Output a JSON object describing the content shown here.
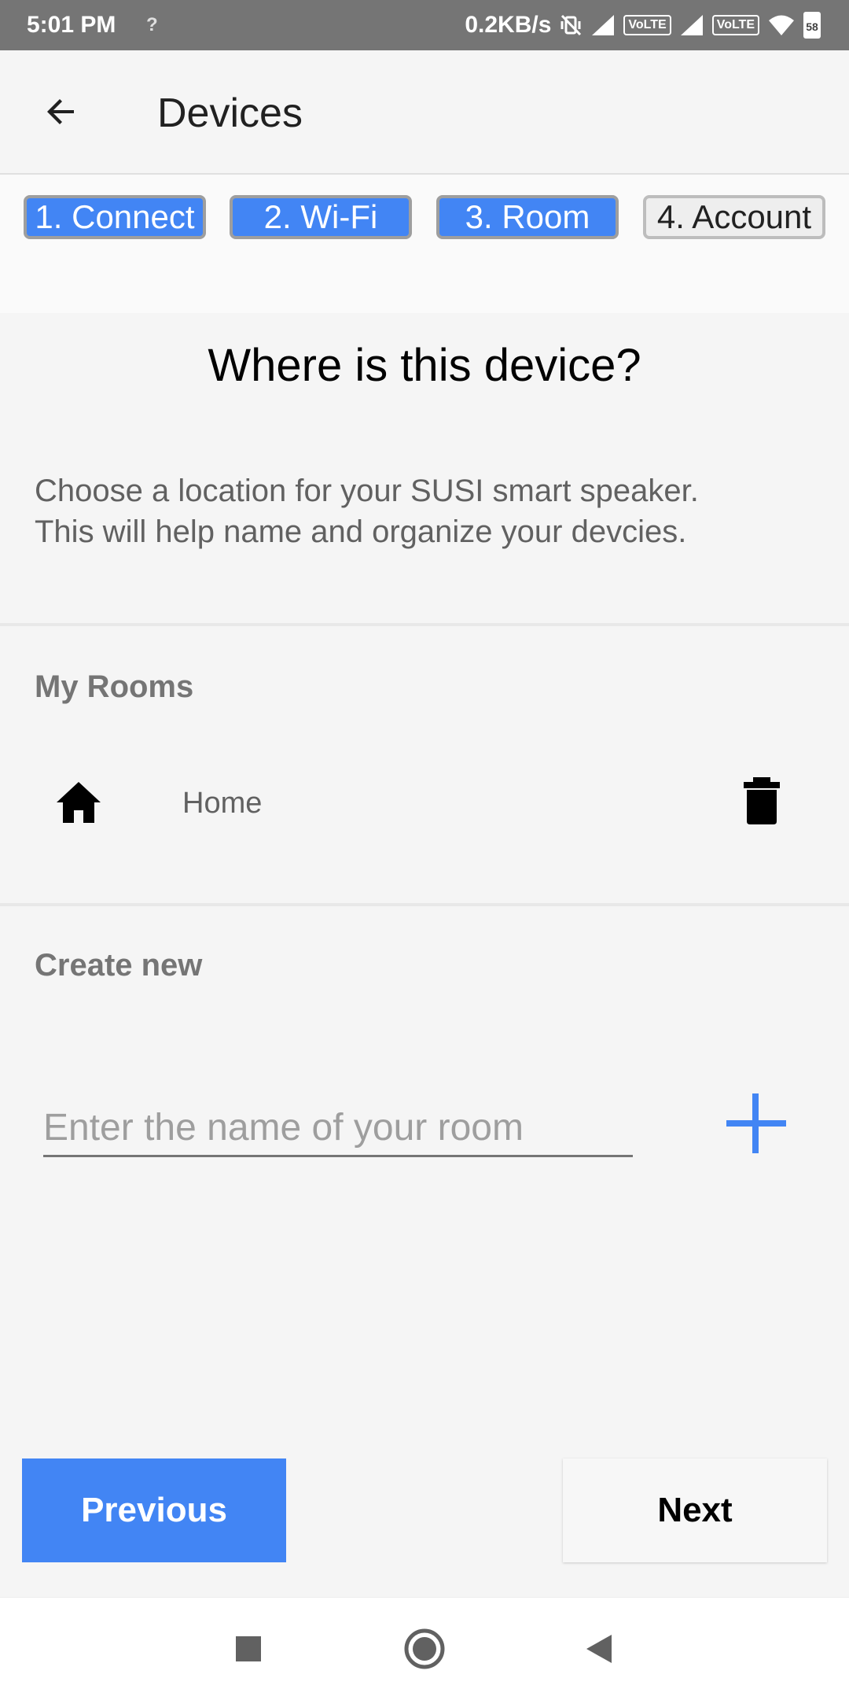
{
  "status_bar": {
    "time": "5:01 PM",
    "unknown_network_glyph": "?",
    "network_speed": "0.2KB/s",
    "volte_1": "VoLTE",
    "volte_2": "VoLTE",
    "battery_level": "58",
    "icons": [
      "wifi-question-icon",
      "vibrate-icon",
      "signal-icon",
      "wifi-icon",
      "battery-icon"
    ]
  },
  "app_bar": {
    "title": "Devices",
    "back_icon": "arrow-left-icon"
  },
  "stepper": {
    "steps": [
      {
        "label": "1. Connect",
        "state": "done"
      },
      {
        "label": "2. Wi-Fi",
        "state": "done"
      },
      {
        "label": "3. Room",
        "state": "current"
      },
      {
        "label": "4. Account",
        "state": "pending"
      }
    ]
  },
  "room_page": {
    "heading": "Where is this device?",
    "description_line1": "Choose a location for your SUSI smart speaker.",
    "description_line2": "This will help name and organize your devcies."
  },
  "my_rooms": {
    "title": "My Rooms",
    "rooms": [
      {
        "name": "Home",
        "icon": "home-icon",
        "action_icon": "trash-icon"
      }
    ]
  },
  "create_new": {
    "title": "Create new",
    "input_value": "",
    "input_placeholder": "Enter the name of your room",
    "add_icon": "plus-icon"
  },
  "footer_buttons": {
    "previous_label": "Previous",
    "next_label": "Next"
  },
  "nav_bar": {
    "icons": [
      "recents-square-icon",
      "home-circle-icon",
      "back-triangle-icon"
    ]
  },
  "colors": {
    "accent": "#4285f4",
    "status_bar": "#757575",
    "background": "#f5f5f5"
  }
}
